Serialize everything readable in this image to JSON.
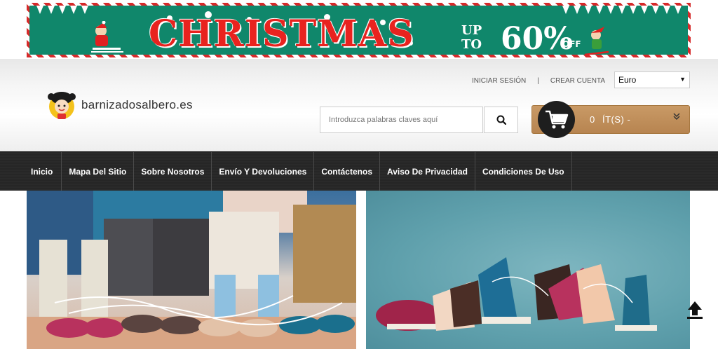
{
  "banner": {
    "title": "CHRISTMAS",
    "upto_line1": "UP",
    "upto_line2": "TO",
    "percent": "60%",
    "off": "OFF"
  },
  "header": {
    "logo_text": "barnizadosalbero.es",
    "login_link": "INICIAR SESIÓN",
    "separator": "|",
    "register_link": "CREAR CUENTA",
    "currency_selected": "Euro",
    "search_placeholder": "Introduzca palabras claves aquí",
    "cart_count": "0",
    "cart_label": "ÍT(S) -"
  },
  "nav": {
    "items": [
      "Inicio",
      "Mapa Del Sitio",
      "Sobre Nosotros",
      "Envío Y Devoluciones",
      "Contáctenos",
      "Aviso De Privacidad",
      "Condiciones De Uso"
    ]
  },
  "icons": {
    "search": "search-icon",
    "cart": "cart-icon",
    "chevron": "chevron-down-icon",
    "scroll_top": "scroll-to-top-icon"
  },
  "colors": {
    "banner_bg": "#10876b",
    "banner_title": "#e8231f",
    "nav_bg": "#262626",
    "cart_bg": "#b78450"
  }
}
